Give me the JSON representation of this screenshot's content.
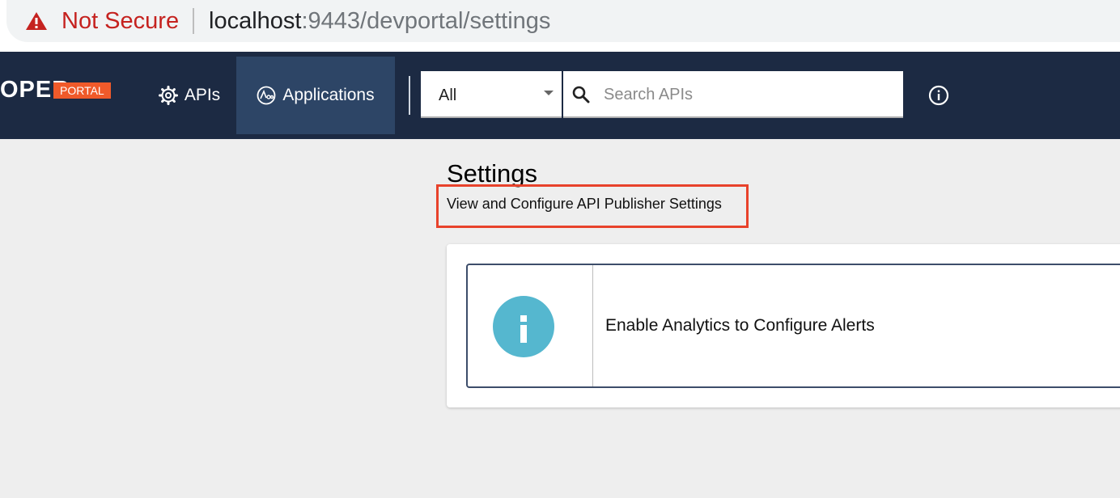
{
  "browser": {
    "security_label": "Not Secure",
    "url_host": "localhost",
    "url_rest": ":9443/devportal/settings"
  },
  "header": {
    "logo_text": "OPER",
    "logo_badge": "PORTAL",
    "nav": {
      "apis_label": "APIs",
      "applications_label": "Applications"
    },
    "search": {
      "scope_value": "All",
      "placeholder": "Search APIs"
    }
  },
  "main": {
    "title": "Settings",
    "subtitle": "View and Configure API Publisher Settings",
    "alert_text": "Enable Analytics to Configure Alerts"
  },
  "colors": {
    "header_bg": "#1c2a43",
    "active_nav_bg": "#2d4566",
    "brand_accent": "#f05a2a",
    "highlight_border": "#e8422b",
    "info_circle": "#55b7cf",
    "warning_red": "#c5221f"
  },
  "icons": [
    "warning-icon",
    "gear-icon",
    "applications-icon",
    "chevron-down-icon",
    "search-icon",
    "info-icon",
    "info-circle-icon"
  ]
}
